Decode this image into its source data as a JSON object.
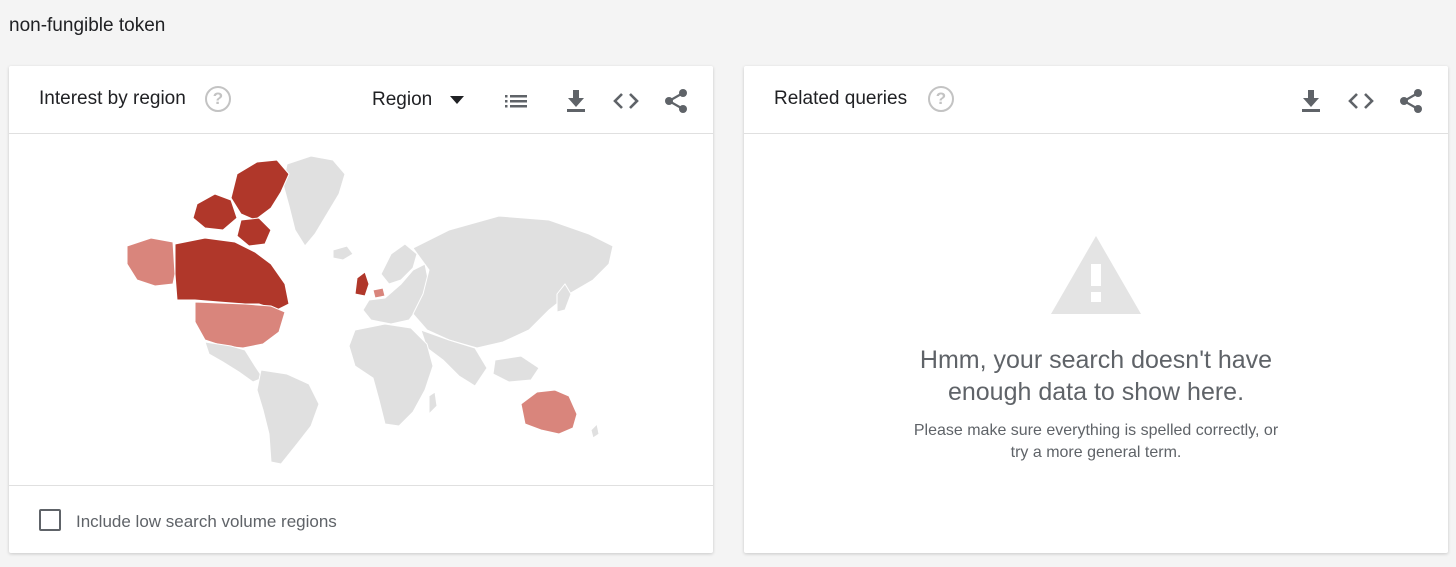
{
  "search_term": "non-fungible token",
  "interest_by_region": {
    "title": "Interest by region",
    "help_icon": "help-circle-icon",
    "resolution_select": {
      "selected": "Region"
    },
    "icons": [
      "list-icon",
      "download-icon",
      "embed-code-icon",
      "share-icon"
    ],
    "map": {
      "highlighted_regions": [
        {
          "name": "Canada",
          "level": "high",
          "color": "#b0372a"
        },
        {
          "name": "United States",
          "level": "medium",
          "color": "#d9857c"
        },
        {
          "name": "Alaska",
          "level": "medium",
          "color": "#d9857c"
        },
        {
          "name": "Australia",
          "level": "medium",
          "color": "#d9857c"
        },
        {
          "name": "United Kingdom",
          "level": "high",
          "color": "#b0372a"
        },
        {
          "name": "Netherlands",
          "level": "medium",
          "color": "#d9857c"
        }
      ],
      "base_color": "#e0e0e0"
    },
    "footer": {
      "checkbox_label": "Include low search volume regions",
      "checked": false
    }
  },
  "related_queries": {
    "title": "Related queries",
    "help_icon": "help-circle-icon",
    "icons": [
      "download-icon",
      "embed-code-icon",
      "share-icon"
    ],
    "empty_state": {
      "icon": "warning-icon",
      "title_line1": "Hmm, your search doesn't have",
      "title_line2": "enough data to show here.",
      "sub_line1": "Please make sure everything is spelled correctly, or",
      "sub_line2": "try a more general term."
    }
  }
}
